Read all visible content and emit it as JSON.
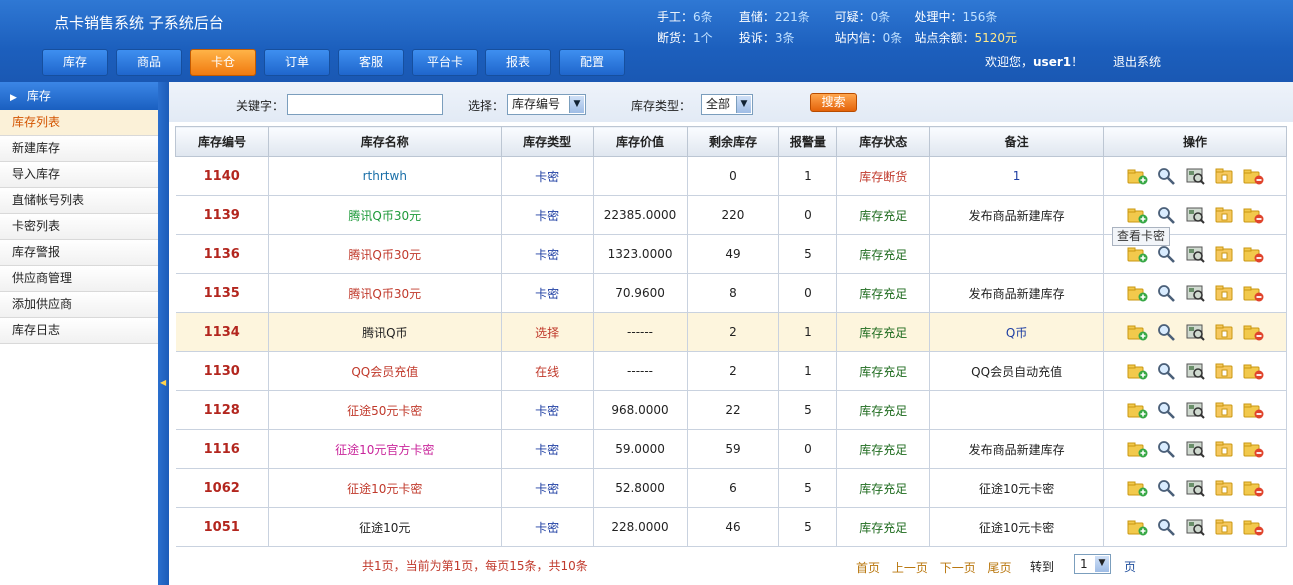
{
  "app": {
    "title": "点卡销售系统 子系统后台"
  },
  "stats": {
    "row1": [
      {
        "label": "手工：",
        "value": "6条"
      },
      {
        "label": "直储：",
        "value": "221条"
      },
      {
        "label": "可疑：",
        "value": "0条"
      },
      {
        "label": "处理中：",
        "value": "156条"
      }
    ],
    "row2": [
      {
        "label": "断货：",
        "value": "1个"
      },
      {
        "label": "投诉：",
        "value": "3条"
      },
      {
        "label": "站内信：",
        "value": "0条"
      },
      {
        "label": "站点余额：",
        "value": "5120元"
      }
    ]
  },
  "nav": [
    "库存",
    "商品",
    "卡仓",
    "订单",
    "客服",
    "平台卡",
    "报表",
    "配置"
  ],
  "nav_active": "卡仓",
  "user": {
    "welcome": "欢迎您，",
    "name": "user1",
    "suffix": "！",
    "logout": "退出系统"
  },
  "sidebar": {
    "header": "库存",
    "items": [
      "库存列表",
      "新建库存",
      "导入库存",
      "直储帐号列表",
      "卡密列表",
      "库存警报",
      "供应商管理",
      "添加供应商",
      "库存日志"
    ],
    "active": "库存列表"
  },
  "search": {
    "keyword_label": "关键字：",
    "keyword_value": "",
    "select_label": "选择：",
    "select_value": "库存编号",
    "type_label": "库存类型：",
    "type_value": "全部",
    "button": "搜索"
  },
  "table": {
    "columns": [
      "库存编号",
      "库存名称",
      "库存类型",
      "库存价值",
      "剩余库存",
      "报警量",
      "库存状态",
      "备注",
      "操作"
    ],
    "rows": [
      {
        "id": "1140",
        "name": "rthrtwh",
        "type": "卡密",
        "value": "",
        "remain": "0",
        "alarm": "1",
        "status": "库存断货",
        "note": "1"
      },
      {
        "id": "1139",
        "name": "腾讯Q币30元",
        "type": "卡密",
        "value": "22385.0000",
        "remain": "220",
        "alarm": "0",
        "status": "库存充足",
        "note": "发布商品新建库存"
      },
      {
        "id": "1136",
        "name": "腾讯Q币30元",
        "type": "卡密",
        "value": "1323.0000",
        "remain": "49",
        "alarm": "5",
        "status": "库存充足",
        "note": ""
      },
      {
        "id": "1135",
        "name": "腾讯Q币30元",
        "type": "卡密",
        "value": "70.9600",
        "remain": "8",
        "alarm": "0",
        "status": "库存充足",
        "note": "发布商品新建库存"
      },
      {
        "id": "1134",
        "name": "腾讯Q币",
        "type": "选择",
        "value": "------",
        "remain": "2",
        "alarm": "1",
        "status": "库存充足",
        "note": "Q币"
      },
      {
        "id": "1130",
        "name": "QQ会员充值",
        "type": "在线",
        "value": "------",
        "remain": "2",
        "alarm": "1",
        "status": "库存充足",
        "note": "QQ会员自动充值"
      },
      {
        "id": "1128",
        "name": "征途50元卡密",
        "type": "卡密",
        "value": "968.0000",
        "remain": "22",
        "alarm": "5",
        "status": "库存充足",
        "note": ""
      },
      {
        "id": "1116",
        "name": "征途10元官方卡密",
        "type": "卡密",
        "value": "59.0000",
        "remain": "59",
        "alarm": "0",
        "status": "库存充足",
        "note": "发布商品新建库存"
      },
      {
        "id": "1062",
        "name": "征途10元卡密",
        "type": "卡密",
        "value": "52.8000",
        "remain": "6",
        "alarm": "5",
        "status": "库存充足",
        "note": "征途10元卡密"
      },
      {
        "id": "1051",
        "name": "征途10元",
        "type": "卡密",
        "value": "228.0000",
        "remain": "46",
        "alarm": "5",
        "status": "库存充足",
        "note": "征途10元卡密"
      }
    ]
  },
  "tooltip": "查看卡密",
  "pager": {
    "info": "共1页，当前为第1页，每页15条，共10条",
    "first": "首页",
    "prev": "上一页",
    "next": "下一页",
    "last": "尾页",
    "goto": "转到",
    "page_value": "1",
    "suffix": "页"
  },
  "colors": {
    "header_blue": "#1c5fbd",
    "accent_orange": "#f07a10",
    "id_red": "#b3261e",
    "status_ok": "#1e6b1e",
    "status_out": "#c0392b",
    "name_green": "#1e9a3a",
    "name_red": "#c0392b",
    "name_teal": "#1a6fa8",
    "name_magenta": "#c9259b",
    "type_blue": "#1f3fa3",
    "row_highlight": "#fdf5dd"
  },
  "icons": [
    "add-card-icon",
    "search-icon",
    "view-card-icon",
    "edit-card-icon",
    "delete-card-icon"
  ]
}
